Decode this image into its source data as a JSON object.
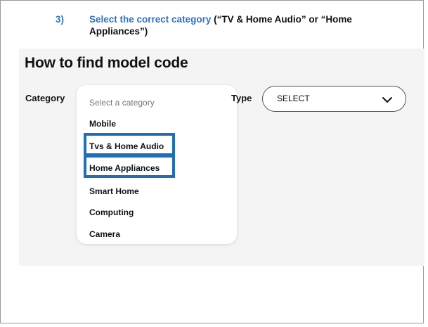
{
  "instruction": {
    "number": "3)",
    "highlight": "Select the correct category",
    "rest_line1": " (“TV & Home Audio” or “Home",
    "rest_line2": "Appliances”)"
  },
  "panel": {
    "title": "How to find model code",
    "category_label": "Category",
    "type_label": "Type",
    "type_value": "SELECT"
  },
  "dropdown": {
    "placeholder": "Select a category",
    "options": [
      "Mobile",
      "Tvs & Home Audio",
      "Home Appliances",
      "Smart Home",
      "Computing",
      "Camera"
    ],
    "highlighted_options": [
      "Tvs & Home Audio",
      "Home Appliances"
    ]
  },
  "colors": {
    "instruction_blue": "#2f73c7",
    "highlight_border": "#1e6fb6",
    "panel_background": "#f4f4f4"
  },
  "icons": {
    "type_select": "chevron-down-icon"
  }
}
